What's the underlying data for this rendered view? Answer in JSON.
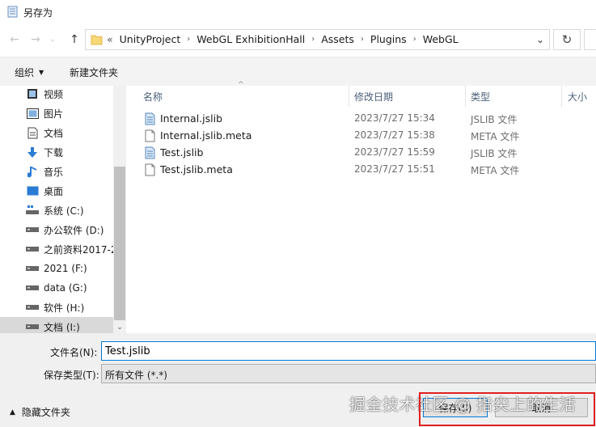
{
  "window": {
    "title": "另存为"
  },
  "nav": {
    "back_glyph": "←",
    "forward_glyph": "→",
    "history_glyph": "⌄",
    "up_glyph": "↑"
  },
  "address": {
    "overflow": "«",
    "crumbs": [
      "UnityProject",
      "WebGL ExhibitionHall",
      "Assets",
      "Plugins",
      "WebGL"
    ],
    "separator": "›",
    "dropdown_glyph": "⌄",
    "refresh_glyph": "↻"
  },
  "toolbar": {
    "organize": "组织",
    "organize_caret": "▼",
    "new_folder": "新建文件夹"
  },
  "sidebar": {
    "items": [
      {
        "label": "视频",
        "icon": "video-icon"
      },
      {
        "label": "图片",
        "icon": "pictures-icon"
      },
      {
        "label": "文档",
        "icon": "documents-icon"
      },
      {
        "label": "下载",
        "icon": "download-icon"
      },
      {
        "label": "音乐",
        "icon": "music-icon"
      },
      {
        "label": "桌面",
        "icon": "desktop-icon"
      },
      {
        "label": "系统 (C:)",
        "icon": "system-drive-icon"
      },
      {
        "label": "办公软件 (D:)",
        "icon": "drive-icon"
      },
      {
        "label": "之前资料2017-2",
        "icon": "drive-icon"
      },
      {
        "label": "2021 (F:)",
        "icon": "drive-icon"
      },
      {
        "label": "data (G:)",
        "icon": "drive-icon"
      },
      {
        "label": "软件 (H:)",
        "icon": "drive-icon"
      },
      {
        "label": "文档 (I:)",
        "icon": "drive-icon",
        "selected": true
      }
    ],
    "scroll_down_glyph": "⌄"
  },
  "columns": {
    "name": "名称",
    "date": "修改日期",
    "type": "类型",
    "size": "大小",
    "sort_glyph": "^"
  },
  "files": [
    {
      "name": "Internal.jslib",
      "date": "2023/7/27 15:34",
      "type": "JSLIB 文件",
      "icon": "jslib-file-icon"
    },
    {
      "name": "Internal.jslib.meta",
      "date": "2023/7/27 15:38",
      "type": "META 文件",
      "icon": "blank-file-icon"
    },
    {
      "name": "Test.jslib",
      "date": "2023/7/27 15:59",
      "type": "JSLIB 文件",
      "icon": "jslib-file-icon"
    },
    {
      "name": "Test.jslib.meta",
      "date": "2023/7/27 15:51",
      "type": "META 文件",
      "icon": "blank-file-icon"
    }
  ],
  "form": {
    "filename_label": "文件名(N):",
    "filename_value": "Test.jslib",
    "filetype_label": "保存类型(T):",
    "filetype_value": "所有文件  (*.*)",
    "hide_folders": "隐藏文件夹",
    "hide_caret": "▲",
    "save_label": "保存(S)",
    "cancel_label": "取消"
  },
  "watermark": "掘金技术社区 @ 指尖上的生活",
  "colors": {
    "accent": "#0078d7",
    "highlight": "#e02020",
    "folder": "#f8d775"
  }
}
